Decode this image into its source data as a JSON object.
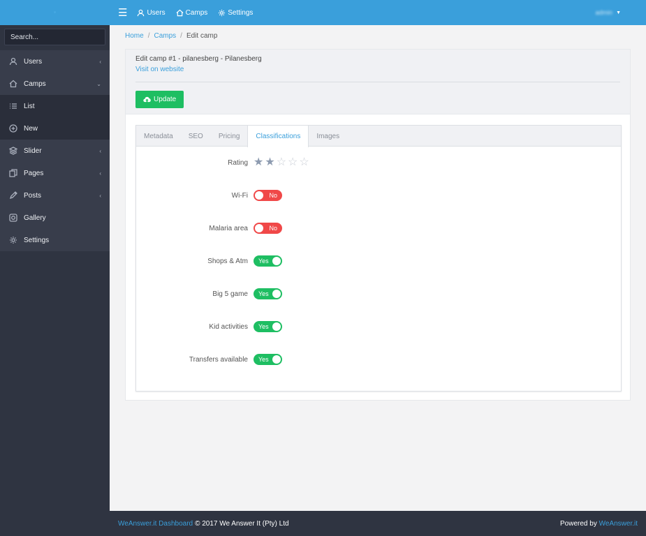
{
  "sidebar": {
    "search_placeholder": "Search...",
    "items": [
      {
        "label": "Users",
        "icon": "user-icon",
        "chevron": "‹"
      },
      {
        "label": "Camps",
        "icon": "home-icon",
        "chevron": "⌄"
      },
      {
        "label": "List",
        "icon": "list-icon",
        "chevron": ""
      },
      {
        "label": "New",
        "icon": "plus-circle-icon",
        "chevron": ""
      },
      {
        "label": "Slider",
        "icon": "layers-icon",
        "chevron": "‹"
      },
      {
        "label": "Pages",
        "icon": "copy-icon",
        "chevron": "‹"
      },
      {
        "label": "Posts",
        "icon": "pencil-icon",
        "chevron": "‹"
      },
      {
        "label": "Gallery",
        "icon": "camera-icon",
        "chevron": ""
      },
      {
        "label": "Settings",
        "icon": "gear-icon",
        "chevron": ""
      }
    ]
  },
  "topbar": {
    "menu_icon": "☰",
    "links": [
      {
        "label": "Users",
        "icon": "user-icon"
      },
      {
        "label": "Camps",
        "icon": "home-icon"
      },
      {
        "label": "Settings",
        "icon": "gear-icon"
      }
    ],
    "user": "admin"
  },
  "breadcrumb": {
    "home": "Home",
    "camps": "Camps",
    "current": "Edit camp",
    "separator": "/"
  },
  "card": {
    "title": "Edit camp #1 - pilanesberg - Pilanesberg",
    "visit_link": "Visit on website",
    "update_button": "Update"
  },
  "tabs": [
    "Metadata",
    "SEO",
    "Pricing",
    "Classifications",
    "Images"
  ],
  "active_tab": "Classifications",
  "classifications": {
    "rating_label": "Rating",
    "rating": 2,
    "rating_max": 5,
    "toggles": [
      {
        "label": "Wi-Fi",
        "value": "No"
      },
      {
        "label": "Malaria area",
        "value": "No"
      },
      {
        "label": "Shops & Atm",
        "value": "Yes"
      },
      {
        "label": "Big 5 game",
        "value": "Yes"
      },
      {
        "label": "Kid activities",
        "value": "Yes"
      },
      {
        "label": "Transfers available",
        "value": "Yes"
      }
    ]
  },
  "footer": {
    "brand_link": "WeAnswer.it Dashboard",
    "copyright": "© 2017 We Answer It (Pty) Ltd",
    "powered_by": "Powered by",
    "powered_link": "WeAnswer.it"
  },
  "colors": {
    "primary": "#3a9fdb",
    "sidebar": "#2f3441",
    "success": "#1ebe62",
    "danger": "#f04848"
  }
}
